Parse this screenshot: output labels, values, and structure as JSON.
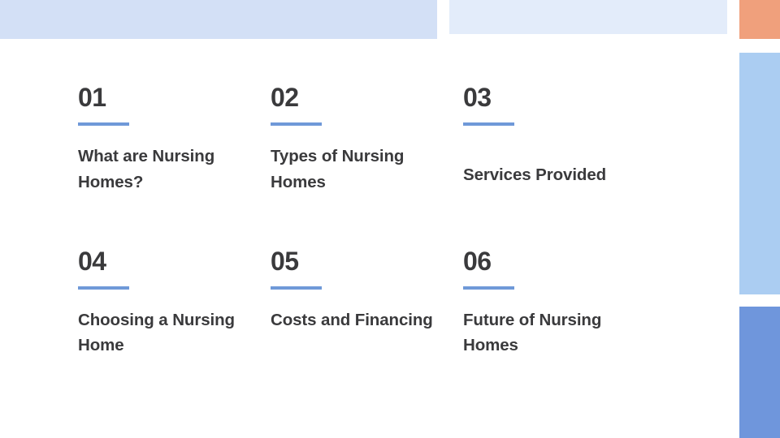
{
  "slide": {
    "type": "agenda-slide",
    "background_color": "#ffffff",
    "decorations": [
      {
        "name": "top-left-band",
        "color": "#d3e0f6"
      },
      {
        "name": "top-middle-band",
        "color": "#e3ecfa"
      },
      {
        "name": "right-orange-block",
        "color": "#f0a07c"
      },
      {
        "name": "right-lightblue-block",
        "color": "#abcdf2"
      },
      {
        "name": "right-blue-block",
        "color": "#6f96dc"
      }
    ],
    "accent_color": "#6f99d8",
    "text_color": "#3a3a3c"
  },
  "agenda": {
    "items": [
      {
        "number": "01",
        "title": "What are Nursing Homes?"
      },
      {
        "number": "02",
        "title": "Types of Nursing Homes"
      },
      {
        "number": "03",
        "title": "Services Provided"
      },
      {
        "number": "04",
        "title": "Choosing a Nursing Home"
      },
      {
        "number": "05",
        "title": "Costs and Financing"
      },
      {
        "number": "06",
        "title": "Future of Nursing Homes"
      }
    ]
  }
}
